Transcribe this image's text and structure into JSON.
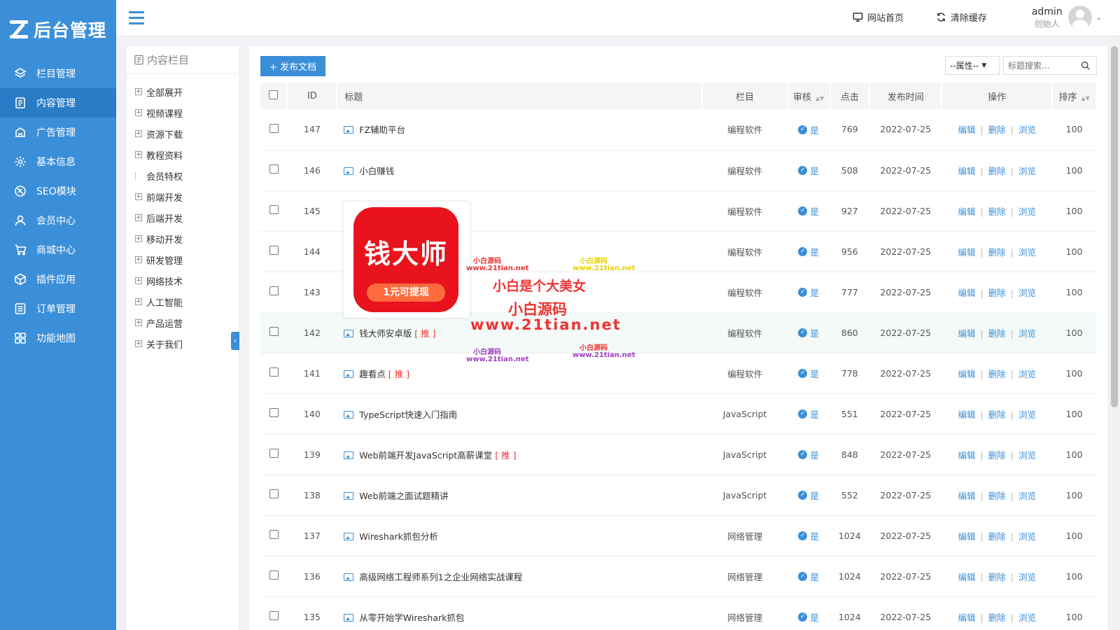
{
  "sidebar": {
    "logo_text": "后台管理",
    "items": [
      {
        "label": "栏目管理",
        "icon": "layers-icon"
      },
      {
        "label": "内容管理",
        "icon": "document-icon",
        "active": true
      },
      {
        "label": "广告管理",
        "icon": "ad-icon"
      },
      {
        "label": "基本信息",
        "icon": "gear-icon"
      },
      {
        "label": "SEO模块",
        "icon": "seo-icon"
      },
      {
        "label": "会员中心",
        "icon": "user-icon"
      },
      {
        "label": "商城中心",
        "icon": "cart-icon"
      },
      {
        "label": "插件应用",
        "icon": "cube-icon"
      },
      {
        "label": "订单管理",
        "icon": "list-icon"
      },
      {
        "label": "功能地图",
        "icon": "grid-icon"
      }
    ]
  },
  "header": {
    "site_home": "网站首页",
    "clear_cache": "清除缓存",
    "user_name": "admin",
    "user_role": "创始人"
  },
  "categories": {
    "title": "内容栏目",
    "items": [
      "全部展开",
      "视频课程",
      "资源下载",
      "教程资料",
      "会员特权",
      "前端开发",
      "后端开发",
      "移动开发",
      "研发管理",
      "网络技术",
      "人工智能",
      "产品运营",
      "关于我们"
    ]
  },
  "toolbar": {
    "publish_label": "+ 发布文档",
    "attr_select": "--属性--",
    "search_placeholder": "标题搜索..."
  },
  "table": {
    "headers": {
      "id": "ID",
      "title": "标题",
      "category": "栏目",
      "audit": "审核",
      "clicks": "点击",
      "date": "发布时间",
      "ops": "操作",
      "sort": "排序"
    },
    "rec_tag": "[ 推 ]",
    "audit_yes": "是",
    "op_edit": "编辑",
    "op_delete": "删除",
    "op_view": "浏览",
    "rows": [
      {
        "id": "147",
        "title": "FZ辅助平台",
        "rec": false,
        "category": "编程软件",
        "clicks": "769",
        "date": "2022-07-25",
        "sort": "100"
      },
      {
        "id": "146",
        "title": "小白赚钱",
        "rec": false,
        "category": "编程软件",
        "clicks": "508",
        "date": "2022-07-25",
        "sort": "100"
      },
      {
        "id": "145",
        "title": "",
        "rec": false,
        "category": "编程软件",
        "clicks": "927",
        "date": "2022-07-25",
        "sort": "100"
      },
      {
        "id": "144",
        "title": "",
        "rec": false,
        "category": "编程软件",
        "clicks": "956",
        "date": "2022-07-25",
        "sort": "100"
      },
      {
        "id": "143",
        "title": "",
        "rec": false,
        "category": "编程软件",
        "clicks": "777",
        "date": "2022-07-25",
        "sort": "100"
      },
      {
        "id": "142",
        "title": "钱大师安卓版",
        "rec": true,
        "category": "编程软件",
        "clicks": "860",
        "date": "2022-07-25",
        "sort": "100",
        "highlight": true
      },
      {
        "id": "141",
        "title": "趣看点",
        "rec": true,
        "category": "编程软件",
        "clicks": "778",
        "date": "2022-07-25",
        "sort": "100"
      },
      {
        "id": "140",
        "title": "TypeScript快速入门指南",
        "rec": false,
        "category": "JavaScript",
        "clicks": "551",
        "date": "2022-07-25",
        "sort": "100"
      },
      {
        "id": "139",
        "title": "Web前端开发JavaScript高薪课堂",
        "rec": true,
        "category": "JavaScript",
        "clicks": "848",
        "date": "2022-07-25",
        "sort": "100"
      },
      {
        "id": "138",
        "title": "Web前端之面试题精讲",
        "rec": false,
        "category": "JavaScript",
        "clicks": "552",
        "date": "2022-07-25",
        "sort": "100"
      },
      {
        "id": "137",
        "title": "Wireshark抓包分析",
        "rec": false,
        "category": "网络管理",
        "clicks": "1024",
        "date": "2022-07-25",
        "sort": "100"
      },
      {
        "id": "136",
        "title": "高级网络工程师系列1之企业网络实战课程",
        "rec": false,
        "category": "网络管理",
        "clicks": "1024",
        "date": "2022-07-25",
        "sort": "100"
      },
      {
        "id": "135",
        "title": "从零开始学Wireshark抓包",
        "rec": false,
        "category": "网络管理",
        "clicks": "1024",
        "date": "2022-07-25",
        "sort": "100"
      }
    ]
  },
  "overlay": {
    "app_name": "钱大师",
    "app_slogan": "1元可提现",
    "wm_small": "小白源码",
    "wm_url": "www.21tian.net",
    "wm_main": "小白是个大美女",
    "wm_big": "小白源码",
    "wm_big_url": "www.21tian.net"
  }
}
